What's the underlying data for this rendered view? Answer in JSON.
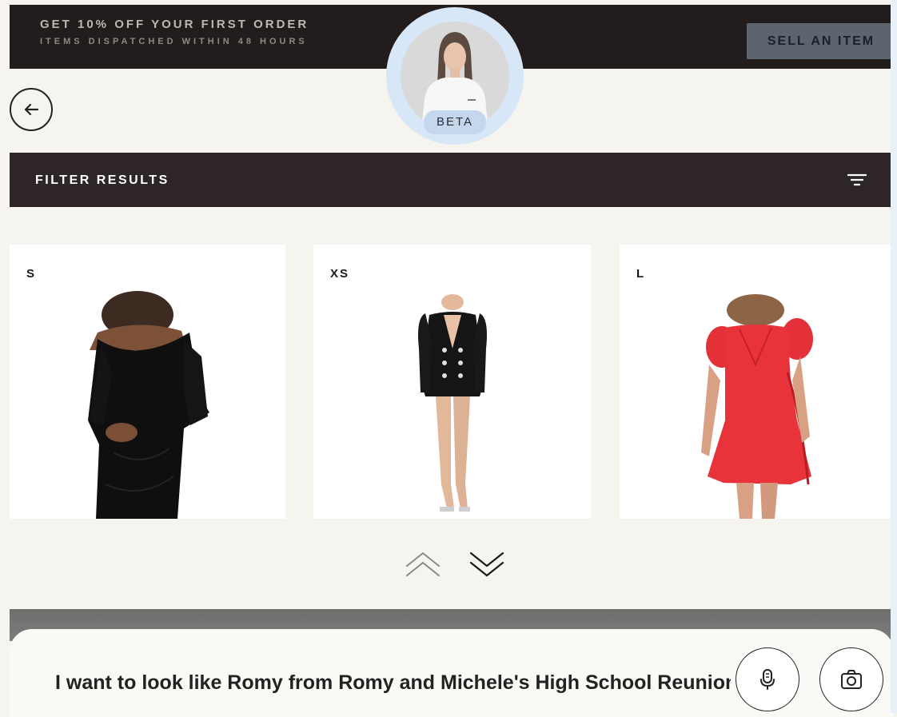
{
  "promo": {
    "line1": "GET 10% OFF YOUR FIRST ORDER",
    "line2": "ITEMS DISPATCHED WITHIN 48 HOURS"
  },
  "header": {
    "sell_label": "SELL AN ITEM",
    "beta_label": "BETA"
  },
  "filter": {
    "label": "FILTER RESULTS"
  },
  "products": [
    {
      "size": "S",
      "color": "#0f0f10"
    },
    {
      "size": "XS",
      "color": "#151515"
    },
    {
      "size": "L",
      "color": "#e8333a"
    }
  ],
  "chat": {
    "input_value": "I want to look like Romy from Romy and Michele's High School Reunion"
  },
  "colors": {
    "promo_bg": "#221c1c",
    "filter_bg": "#2e2626",
    "sell_bg": "#5c6470",
    "avatar_ring": "#d7e7f7"
  }
}
